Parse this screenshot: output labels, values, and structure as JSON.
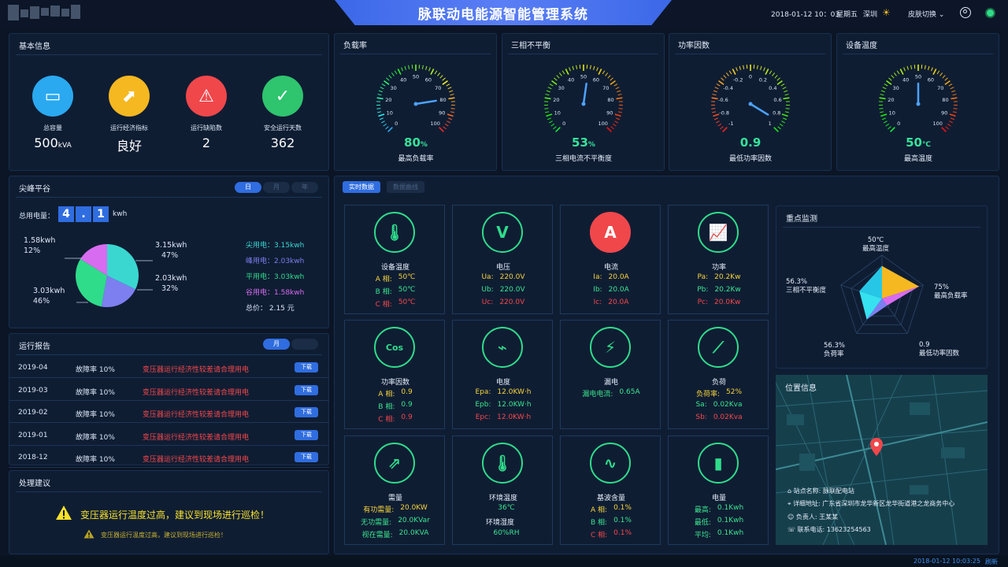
{
  "header": {
    "title": "脉联动电能源智能管理系统",
    "datetime": "2018-01-12  10：03",
    "weekday": "星期五",
    "city": "深圳",
    "skin_switch": "皮肤切换"
  },
  "basic_info": {
    "title": "基本信息",
    "items": [
      {
        "label": "总容量",
        "value": "500",
        "unit": "kVA",
        "color": "#2aa9f0",
        "icon": "chart-window-icon"
      },
      {
        "label": "运行经济指标",
        "value": "良好",
        "unit": "",
        "color": "#f5b820",
        "icon": "trend-icon"
      },
      {
        "label": "运行缺陷数",
        "value": "2",
        "unit": "",
        "color": "#f0474b",
        "icon": "warning-icon"
      },
      {
        "label": "安全运行天数",
        "value": "362",
        "unit": "",
        "color": "#2fc46e",
        "icon": "shield-check-icon"
      }
    ]
  },
  "gauges": [
    {
      "title": "负载率",
      "ticks": [
        "0",
        "10",
        "20",
        "30",
        "40",
        "50",
        "60",
        "70",
        "80",
        "90",
        "100"
      ],
      "value": "80",
      "unit": "%",
      "label": "最高负载率",
      "needle_fraction": 0.8
    },
    {
      "title": "三相不平衡",
      "ticks": [
        "0",
        "10",
        "20",
        "30",
        "40",
        "50",
        "60",
        "70",
        "80",
        "90",
        "100"
      ],
      "value": "53",
      "unit": "%",
      "label": "三相电流不平衡度",
      "needle_fraction": 0.53
    },
    {
      "title": "功率因数",
      "ticks": [
        "-1",
        "-0.8",
        "-0.6",
        "-0.4",
        "-0.2",
        "0",
        "0.2",
        "0.4",
        "0.6",
        "0.8",
        "1"
      ],
      "value": "0.9",
      "unit": "",
      "label": "最低功率因数",
      "needle_fraction": 0.95
    },
    {
      "title": "设备温度",
      "ticks": [
        "0",
        "10",
        "20",
        "30",
        "40",
        "50",
        "60",
        "70",
        "80",
        "90",
        "100"
      ],
      "value": "50",
      "unit": "℃",
      "label": "最高温度",
      "needle_fraction": 0.5
    }
  ],
  "peak": {
    "title": "尖峰平谷",
    "tabs": [
      "日",
      "月",
      "年"
    ],
    "total_label": "总用电量：",
    "total_digits": [
      "4",
      ".",
      "1"
    ],
    "total_unit": "kwh",
    "legend": [
      {
        "text": "尖用电：3.15kwh",
        "color": "#3ad7d0"
      },
      {
        "text": "峰用电：2.03kwh",
        "color": "#7d7ff0"
      },
      {
        "text": "平用电：3.03kwh",
        "color": "#2fdc8a"
      },
      {
        "text": "谷用电：1.58kwh",
        "color": "#d86cf0"
      }
    ],
    "total_price": "总价：  2.15 元",
    "labels": [
      {
        "kwh": "3.15kwh",
        "pct": "47%"
      },
      {
        "kwh": "2.03kwh",
        "pct": "32%"
      },
      {
        "kwh": "3.03kwh",
        "pct": "46%"
      },
      {
        "kwh": "1.58kwh",
        "pct": "12%"
      }
    ]
  },
  "chart_data": {
    "type": "pie",
    "categories": [
      "尖用电",
      "峰用电",
      "平用电",
      "谷用电"
    ],
    "values": [
      3.15,
      2.03,
      3.03,
      1.58
    ],
    "colors": [
      "#3ad7d0",
      "#7d7ff0",
      "#2fdc8a",
      "#d86cf0"
    ]
  },
  "report": {
    "title": "运行报告",
    "tabs": [
      "月",
      ""
    ],
    "rows": [
      {
        "date": "2019-04",
        "rate": "故障率 10%",
        "desc": "变压器运行经济性较差请合理用电",
        "btn": "下载"
      },
      {
        "date": "2019-03",
        "rate": "故障率 10%",
        "desc": "变压器运行经济性较差请合理用电",
        "btn": "下载"
      },
      {
        "date": "2019-02",
        "rate": "故障率 10%",
        "desc": "变压器运行经济性较差请合理用电",
        "btn": "下载"
      },
      {
        "date": "2019-01",
        "rate": "故障率 10%",
        "desc": "变压器运行经济性较差请合理用电",
        "btn": "下载"
      },
      {
        "date": "2018-12",
        "rate": "故障率 10%",
        "desc": "变压器运行经济性较差请合理用电",
        "btn": "下载"
      }
    ]
  },
  "advice": {
    "title": "处理建议",
    "main": "变压器运行温度过高，建议到现场进行巡检！",
    "sub": "变压器运行温度过高，建议到现场进行巡检！"
  },
  "realtime": {
    "tabs": [
      "实时数据",
      "数据曲线"
    ],
    "cards": [
      {
        "name": "设备温度",
        "icon": "thermometer-icon",
        "rows": [
          {
            "k": "A 相:",
            "v": "50℃",
            "c": "cy"
          },
          {
            "k": "B 相:",
            "v": "50℃",
            "c": "cg"
          },
          {
            "k": "C 相:",
            "v": "50℃",
            "c": "cr"
          }
        ]
      },
      {
        "name": "电压",
        "icon": "voltage-icon",
        "rows": [
          {
            "k": "Ua:",
            "v": "220.0V",
            "c": "cy"
          },
          {
            "k": "Ub:",
            "v": "220.0V",
            "c": "cg"
          },
          {
            "k": "Uc:",
            "v": "220.0V",
            "c": "cr"
          }
        ]
      },
      {
        "name": "电流",
        "icon": "current-icon",
        "rows": [
          {
            "k": "Ia:",
            "v": "20.0A",
            "c": "cy"
          },
          {
            "k": "Ib:",
            "v": "20.0A",
            "c": "cg"
          },
          {
            "k": "Ic:",
            "v": "20.0A",
            "c": "cr"
          }
        ]
      },
      {
        "name": "功率",
        "icon": "power-icon",
        "rows": [
          {
            "k": "Pa:",
            "v": "20.2Kw",
            "c": "cy"
          },
          {
            "k": "Pb:",
            "v": "20.2Kw",
            "c": "cg"
          },
          {
            "k": "Pc:",
            "v": "20.0Kw",
            "c": "cr"
          }
        ]
      },
      {
        "name": "功率因数",
        "icon": "cos-icon",
        "rows": [
          {
            "k": "A 相:",
            "v": "0.9",
            "c": "cy"
          },
          {
            "k": "B 相:",
            "v": "0.9",
            "c": "cg"
          },
          {
            "k": "C 相:",
            "v": "0.9",
            "c": "cr"
          }
        ]
      },
      {
        "name": "电度",
        "icon": "energy-meter-icon",
        "rows": [
          {
            "k": "Epa:",
            "v": "12.0KW·h",
            "c": "cy"
          },
          {
            "k": "Epb:",
            "v": "12.0KW·h",
            "c": "cg"
          },
          {
            "k": "Epc:",
            "v": "12.0KW·h",
            "c": "cr"
          }
        ]
      },
      {
        "name": "漏电",
        "icon": "leakage-icon",
        "rows": [
          {
            "k": "漏电电流:",
            "v": "0.65A",
            "c": "cg"
          }
        ]
      },
      {
        "name": "负荷",
        "icon": "load-icon",
        "rows": [
          {
            "k": "负荷率:",
            "v": "52%",
            "c": "cy"
          },
          {
            "k": "Sa:",
            "v": "0.02Kva",
            "c": "cg"
          },
          {
            "k": "Sb:",
            "v": "0.02Kva",
            "c": "cr"
          }
        ]
      },
      {
        "name": "需量",
        "icon": "demand-icon",
        "rows": [
          {
            "k": "有功需量:",
            "v": "20.0KW",
            "c": "cy"
          },
          {
            "k": "无功需量:",
            "v": "20.0KVar",
            "c": "cg"
          },
          {
            "k": "视在需量:",
            "v": "20.0KVA",
            "c": "cg"
          }
        ]
      },
      {
        "name": "环境温度",
        "icon": "env-temp-icon",
        "rows": [
          {
            "k": "",
            "v": "36℃",
            "c": "cg"
          },
          {
            "k": "环境湿度",
            "v": "",
            "c": "cw"
          },
          {
            "k": "",
            "v": "60%RH",
            "c": "cg"
          }
        ]
      },
      {
        "name": "基波含量",
        "icon": "wave-icon",
        "rows": [
          {
            "k": "A 相:",
            "v": "0.1%",
            "c": "cy"
          },
          {
            "k": "B 相:",
            "v": "0.1%",
            "c": "cg"
          },
          {
            "k": "C 相:",
            "v": "0.1%",
            "c": "cr"
          }
        ]
      },
      {
        "name": "电量",
        "icon": "battery-icon",
        "rows": [
          {
            "k": "最高:",
            "v": "0.1Kwh",
            "c": "cg"
          },
          {
            "k": "最低:",
            "v": "0.1Kwh",
            "c": "cg"
          },
          {
            "k": "平均:",
            "v": "0.1Kwh",
            "c": "cg"
          }
        ]
      }
    ]
  },
  "monitor": {
    "title": "重点监测",
    "labels": [
      {
        "value": "50℃",
        "name": "最高温度"
      },
      {
        "value": "75%",
        "name": "最高负载率"
      },
      {
        "value": "0.9",
        "name": "最低功率因数"
      },
      {
        "value": "56.3%",
        "name": "负荷率"
      },
      {
        "value": "56.3%",
        "name": "三相不平衡度"
      }
    ]
  },
  "location": {
    "title": "位置信息",
    "station": "站点名称:  脉联配电站",
    "address": "详细地址:  广东省深圳市龙华新区龙华街道港之龙商务中心",
    "person": "负责人:  王某某",
    "phone": "联系电话:  13623254563"
  },
  "footer": {
    "time": "2018-01-12  10:03:25",
    "refresh": "刷新"
  }
}
